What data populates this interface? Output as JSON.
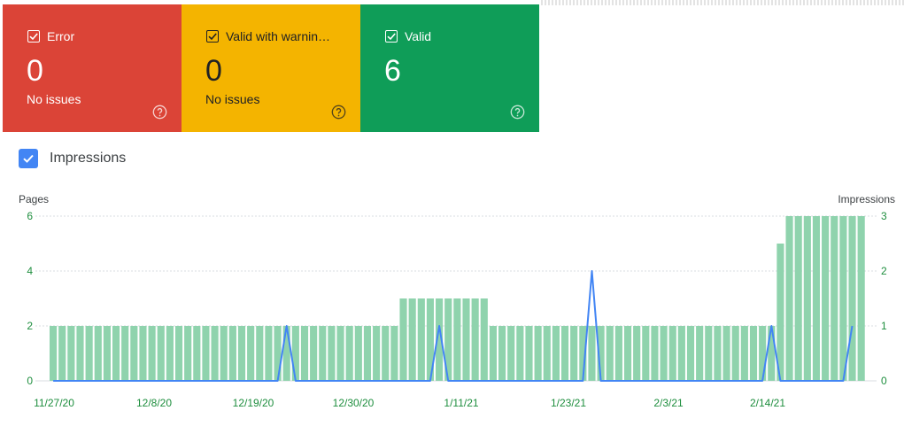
{
  "status_cards": [
    {
      "id": "error",
      "title": "Error",
      "count": "0",
      "subtitle": "No issues",
      "color": "#db4437"
    },
    {
      "id": "warning",
      "title": "Valid with warnin…",
      "count": "0",
      "subtitle": "No issues",
      "color": "#f4b400"
    },
    {
      "id": "valid",
      "title": "Valid",
      "count": "6",
      "subtitle": "",
      "color": "#0f9d58"
    }
  ],
  "metric_toggle": {
    "label": "Impressions",
    "checked": true,
    "color": "#4285f4"
  },
  "chart_data": {
    "type": "bar",
    "left_axis_title": "Pages",
    "right_axis_title": "Impressions",
    "left_ylim": [
      0,
      6
    ],
    "right_ylim": [
      0,
      3
    ],
    "left_ticks": [
      "6",
      "4",
      "2",
      "0"
    ],
    "right_ticks": [
      "3",
      "2",
      "1",
      "0"
    ],
    "x_tick_labels": [
      "11/27/20",
      "12/8/20",
      "12/19/20",
      "12/30/20",
      "1/11/21",
      "1/23/21",
      "2/3/21",
      "2/14/21"
    ],
    "bar_color": "#8fd3ad",
    "line_color": "#4285f4",
    "series": [
      {
        "name": "Pages",
        "axis": "left",
        "start_date": "11/27/20",
        "values": [
          2,
          2,
          2,
          2,
          2,
          2,
          2,
          2,
          2,
          2,
          2,
          2,
          2,
          2,
          2,
          2,
          2,
          2,
          2,
          2,
          2,
          2,
          2,
          2,
          2,
          2,
          2,
          2,
          2,
          2,
          2,
          2,
          2,
          2,
          2,
          2,
          2,
          2,
          2,
          3,
          3,
          3,
          3,
          3,
          3,
          3,
          3,
          3,
          3,
          2,
          2,
          2,
          2,
          2,
          2,
          2,
          2,
          2,
          2,
          2,
          2,
          2,
          2,
          2,
          2,
          2,
          2,
          2,
          2,
          2,
          2,
          2,
          2,
          2,
          2,
          2,
          2,
          2,
          2,
          2,
          2,
          5,
          6,
          6,
          6,
          6,
          6,
          6,
          6,
          6,
          6
        ]
      },
      {
        "name": "Impressions",
        "axis": "right",
        "start_date": "11/27/20",
        "values": [
          0,
          0,
          0,
          0,
          0,
          0,
          0,
          0,
          0,
          0,
          0,
          0,
          0,
          0,
          0,
          0,
          0,
          0,
          0,
          0,
          0,
          0,
          0,
          0,
          0,
          0,
          1,
          0,
          0,
          0,
          0,
          0,
          0,
          0,
          0,
          0,
          0,
          0,
          0,
          0,
          0,
          0,
          0,
          1,
          0,
          0,
          0,
          0,
          0,
          0,
          0,
          0,
          0,
          0,
          0,
          0,
          0,
          0,
          0,
          0,
          2,
          0,
          0,
          0,
          0,
          0,
          0,
          0,
          0,
          0,
          0,
          0,
          0,
          0,
          0,
          0,
          0,
          0,
          0,
          0,
          1,
          0,
          0,
          0,
          0,
          0,
          0,
          0,
          0,
          1
        ]
      }
    ]
  }
}
